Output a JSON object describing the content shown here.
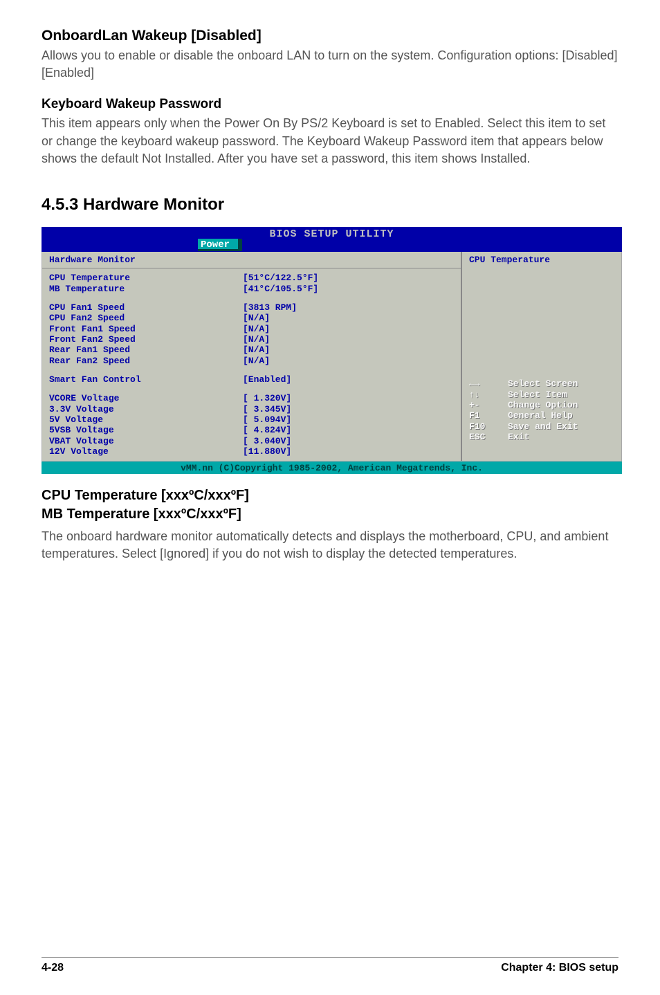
{
  "sec1": {
    "title": "OnboardLan Wakeup [Disabled]",
    "body": "Allows you to enable or disable the onboard LAN to turn on the system. Configuration options: [Disabled] [Enabled]"
  },
  "sec2": {
    "title": "Keyboard Wakeup Password",
    "body": "This item appears only when the Power On By PS/2 Keyboard is set to Enabled. Select this item to set or change the keyboard wakeup password. The Keyboard Wakeup Password item that appears below shows the default Not Installed. After you have set a password, this item shows Installed."
  },
  "section_number": "4.5.3   Hardware Monitor",
  "bios": {
    "utility_title": "BIOS SETUP UTILITY",
    "tab": "Power",
    "panel_title": "Hardware Monitor",
    "help": "CPU Temperature",
    "rows": [
      {
        "label": "CPU Temperature",
        "value": "[51°C/122.5°F]"
      },
      {
        "label": "MB Temperature",
        "value": "[41°C/105.5°F]"
      }
    ],
    "rows2": [
      {
        "label": "CPU Fan1 Speed",
        "value": "[3813 RPM]"
      },
      {
        "label": "CPU Fan2 Speed",
        "value": "[N/A]"
      },
      {
        "label": "Front Fan1 Speed",
        "value": "[N/A]"
      },
      {
        "label": "Front Fan2 Speed",
        "value": "[N/A]"
      },
      {
        "label": "Rear Fan1 Speed",
        "value": "[N/A]"
      },
      {
        "label": "Rear Fan2 Speed",
        "value": "[N/A]"
      }
    ],
    "rows3": [
      {
        "label": "Smart Fan Control",
        "value": "[Enabled]"
      }
    ],
    "rows4": [
      {
        "label": "VCORE Voltage",
        "value": "[ 1.320V]"
      },
      {
        "label": "3.3V Voltage",
        "value": "[ 3.345V]"
      },
      {
        "label": "5V Voltage",
        "value": "[ 5.094V]"
      },
      {
        "label": "5VSB Voltage",
        "value": "[ 4.824V]"
      },
      {
        "label": "VBAT Voltage",
        "value": "[ 3.040V]"
      },
      {
        "label": "12V Voltage",
        "value": "[11.880V]"
      }
    ],
    "legend": [
      {
        "key": "←→",
        "desc": "Select Screen"
      },
      {
        "key": "↑↓",
        "desc": "Select Item"
      },
      {
        "key": "+-",
        "desc": "Change Option"
      },
      {
        "key": "F1",
        "desc": "General Help"
      },
      {
        "key": "F10",
        "desc": "Save and Exit"
      },
      {
        "key": "ESC",
        "desc": "Exit"
      }
    ],
    "footer": "vMM.nn (C)Copyright 1985-2002, American Megatrends, Inc."
  },
  "sec3": {
    "title1": "CPU Temperature [xxxºC/xxxºF]",
    "title2": "MB Temperature [xxxºC/xxxºF]",
    "body": "The onboard hardware monitor automatically detects and displays the motherboard, CPU, and ambient temperatures. Select [Ignored] if you do not wish to display the detected temperatures."
  },
  "footer": {
    "left": "4-28",
    "right": "Chapter 4: BIOS setup"
  }
}
